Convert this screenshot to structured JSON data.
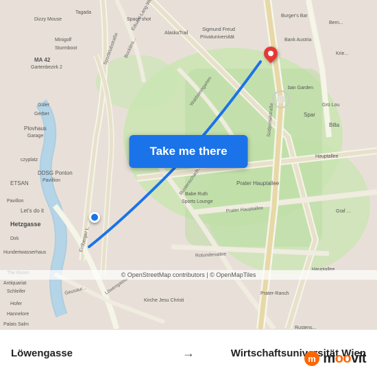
{
  "map": {
    "attribution": "© OpenStreetMap contributors | © OpenMapTiles",
    "background_color": "#e8e0d8"
  },
  "button": {
    "label": "Take me there",
    "bg_color": "#1a73e8"
  },
  "bottom_bar": {
    "from": "Löwengasse",
    "arrow": "→",
    "to": "Wirtschaftsuniversität Wien"
  },
  "logo": {
    "prefix": "moovit",
    "highlight": "o"
  }
}
